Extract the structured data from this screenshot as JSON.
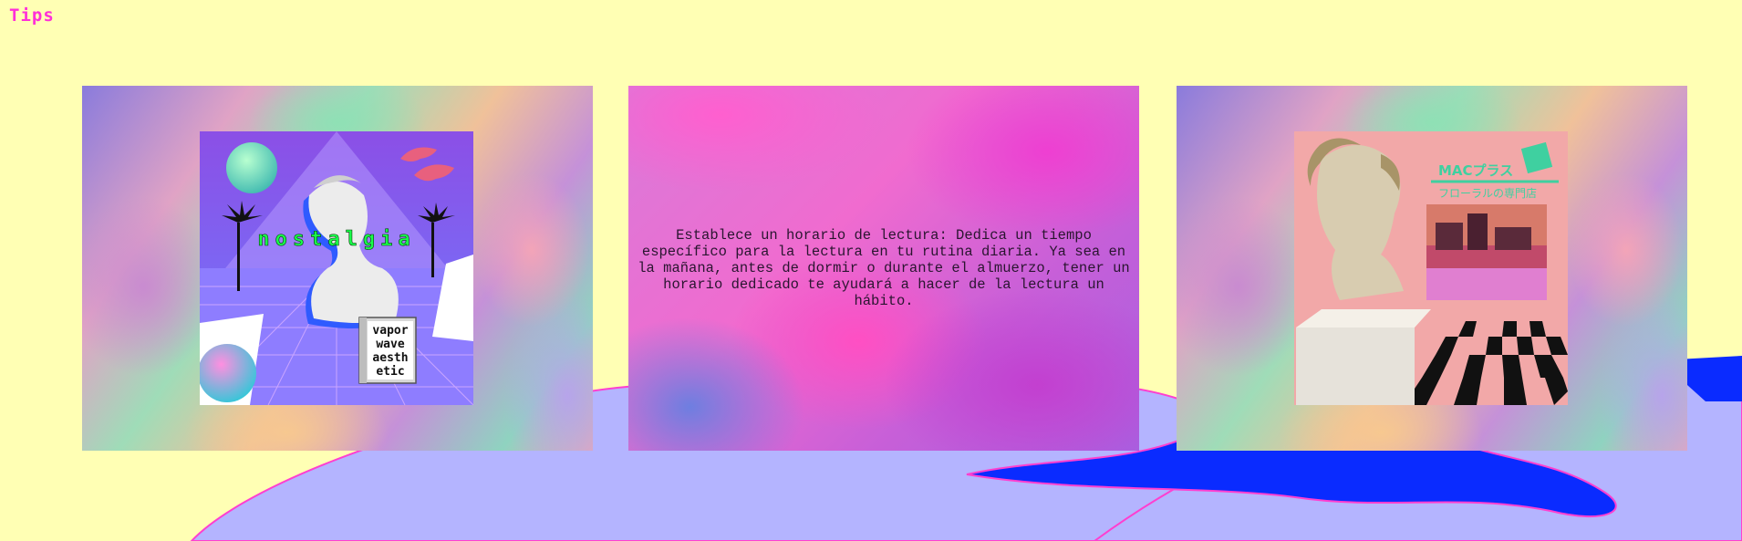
{
  "page": {
    "title": "Tips"
  },
  "cards": [
    {
      "artwork": "nostalgia",
      "art_word": "nostalgia",
      "window_lines": [
        "vapor",
        "wave",
        "aesth",
        "etic"
      ]
    },
    {
      "tip_text": "Establece un horario de lectura: Dedica un tiempo específico para la lectura en tu rutina diaria. Ya sea en la mañana, antes de dormir o durante el almuerzo, tener un horario dedicado te ayudará a hacer de la lectura un hábito."
    },
    {
      "artwork": "floral-shoppe",
      "art_title": "MACプラス",
      "art_subtitle": "フローラルの専門店"
    }
  ],
  "colors": {
    "background": "#ffffb4",
    "title": "#ff2fd8",
    "wave": "#0a2bff",
    "wave_light": "#b4b4ff"
  }
}
